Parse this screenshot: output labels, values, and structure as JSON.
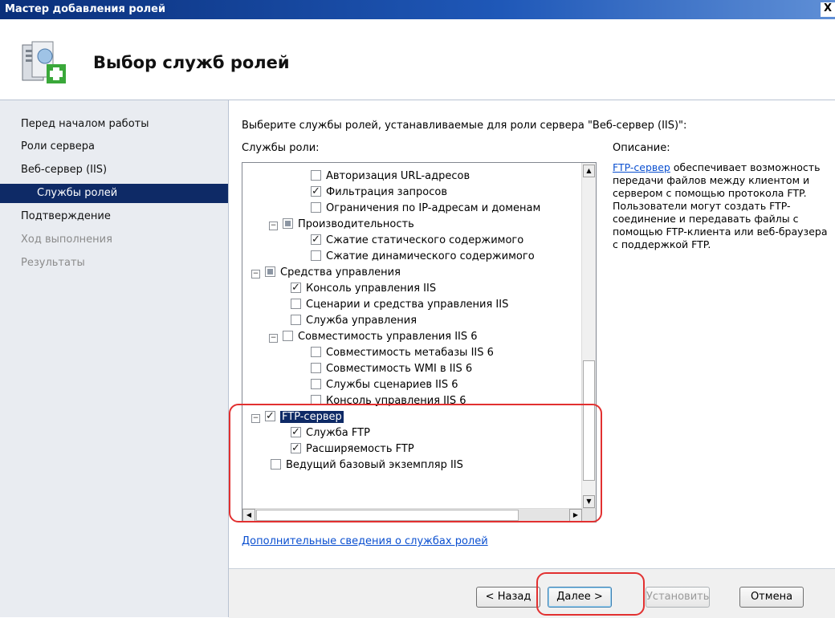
{
  "window": {
    "title": "Мастер добавления ролей",
    "close_label": "X"
  },
  "header": {
    "title": "Выбор служб ролей"
  },
  "nav": [
    {
      "label": "Перед началом работы",
      "state": "normal"
    },
    {
      "label": "Роли сервера",
      "state": "normal"
    },
    {
      "label": "Веб-сервер (IIS)",
      "state": "normal"
    },
    {
      "label": "Службы ролей",
      "state": "active"
    },
    {
      "label": "Подтверждение",
      "state": "normal"
    },
    {
      "label": "Ход выполнения",
      "state": "disabled"
    },
    {
      "label": "Результаты",
      "state": "disabled"
    }
  ],
  "main": {
    "instruction": "Выберите службы ролей, устанавливаемые для роли сервера \"Веб-сервер (IIS)\":",
    "services_label": "Службы роли:",
    "description_label": "Описание:",
    "description_link": "FTP-сервер",
    "description_text": " обеспечивает возможность передачи файлов между клиентом и сервером с помощью протокола FTP. Пользователи могут создать FTP-соединение и передавать файлы с помощью FTP-клиента или веб-браузера с поддержкой FTP.",
    "more_link": "Дополнительные сведения о службах ролей"
  },
  "tree": [
    {
      "label": "Авторизация URL-адресов",
      "state": "unchecked",
      "expander": ""
    },
    {
      "label": "Фильтрация запросов",
      "state": "checked",
      "expander": ""
    },
    {
      "label": "Ограничения по IP-адресам и доменам",
      "state": "unchecked",
      "expander": ""
    },
    {
      "label": "Производительность",
      "state": "partial",
      "expander": "−"
    },
    {
      "label": "Сжатие статического содержимого",
      "state": "checked",
      "expander": ""
    },
    {
      "label": "Сжатие динамического содержимого",
      "state": "unchecked",
      "expander": ""
    },
    {
      "label": "Средства управления",
      "state": "partial",
      "expander": "−"
    },
    {
      "label": "Консоль управления IIS",
      "state": "checked",
      "expander": ""
    },
    {
      "label": "Сценарии и средства управления IIS",
      "state": "unchecked",
      "expander": ""
    },
    {
      "label": "Служба управления",
      "state": "unchecked",
      "expander": ""
    },
    {
      "label": "Совместимость управления IIS 6",
      "state": "unchecked",
      "expander": "−"
    },
    {
      "label": "Совместимость метабазы IIS 6",
      "state": "unchecked",
      "expander": ""
    },
    {
      "label": "Совместимость WMI в IIS 6",
      "state": "unchecked",
      "expander": ""
    },
    {
      "label": "Службы сценариев IIS 6",
      "state": "unchecked",
      "expander": ""
    },
    {
      "label": "Консоль управления IIS 6",
      "state": "unchecked",
      "expander": ""
    },
    {
      "label": "FTP-сервер",
      "state": "checked",
      "expander": "−",
      "selected": true
    },
    {
      "label": "Служба FTP",
      "state": "checked",
      "expander": ""
    },
    {
      "label": "Расширяемость FTP",
      "state": "checked",
      "expander": ""
    },
    {
      "label": "Ведущий базовый экземпляр IIS",
      "state": "unchecked",
      "expander": ""
    }
  ],
  "buttons": {
    "back": "< Назад",
    "next": "Далее >",
    "install": "Установить",
    "cancel": "Отмена"
  }
}
